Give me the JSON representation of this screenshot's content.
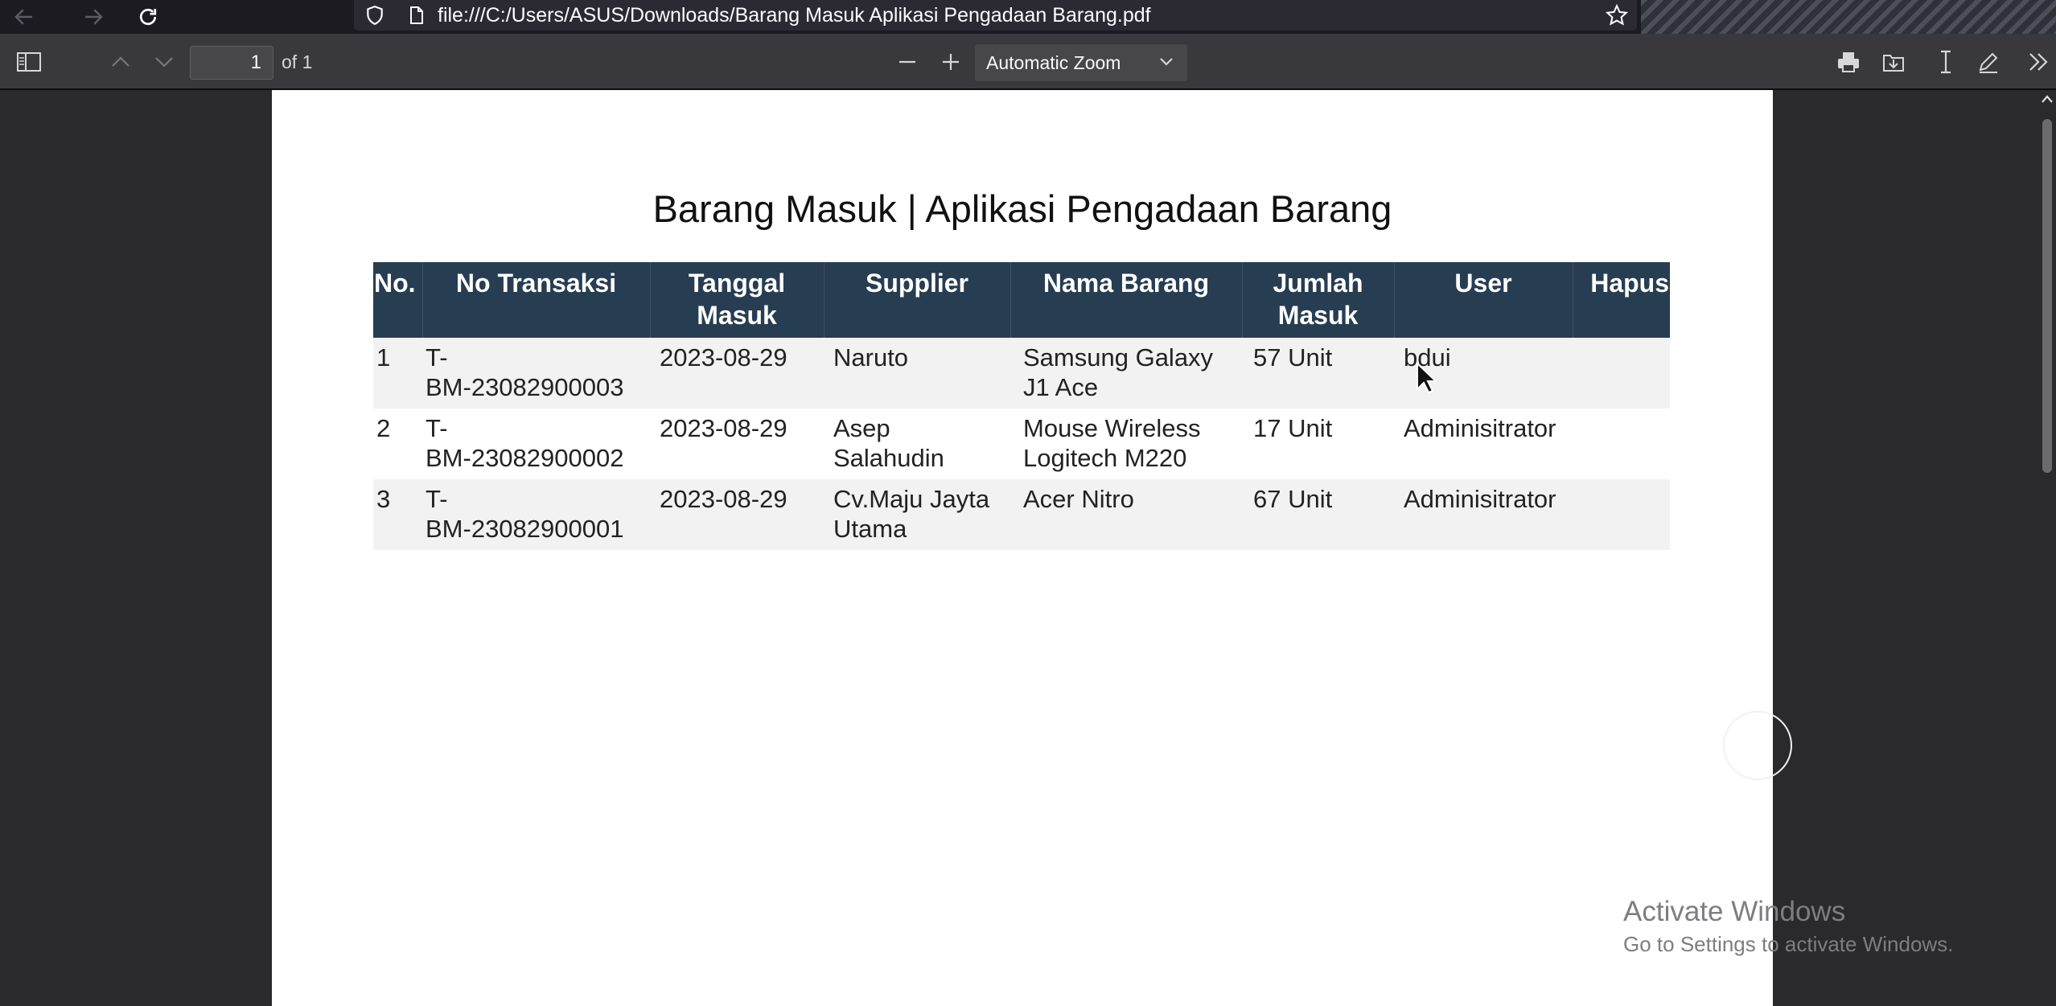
{
  "browser": {
    "url": "file:///C:/Users/ASUS/Downloads/Barang Masuk Aplikasi Pengadaan Barang.pdf"
  },
  "toolbar": {
    "page_number": "1",
    "page_count": "of 1",
    "zoom": "Automatic Zoom"
  },
  "document": {
    "title": "Barang Masuk | Aplikasi Pengadaan Barang",
    "headers": [
      "No.",
      "No Transaksi",
      "Tanggal Masuk",
      "Supplier",
      "Nama Barang",
      "Jumlah Masuk",
      "User",
      "Hapus"
    ],
    "rows": [
      {
        "no": "1",
        "transaksi": "T-BM-23082900003",
        "tanggal": "2023-08-29",
        "supplier": "Naruto",
        "barang": "Samsung Galaxy J1 Ace",
        "jumlah": "57 Unit",
        "user": "bdui",
        "hapus": ""
      },
      {
        "no": "2",
        "transaksi": "T-BM-23082900002",
        "tanggal": "2023-08-29",
        "supplier": "Asep Salahudin",
        "barang": "Mouse Wireless Logitech M220",
        "jumlah": "17 Unit",
        "user": "Adminisitrator",
        "hapus": ""
      },
      {
        "no": "3",
        "transaksi": "T-BM-23082900001",
        "tanggal": "2023-08-29",
        "supplier": "Cv.Maju Jayta Utama",
        "barang": "Acer Nitro",
        "jumlah": "67 Unit",
        "user": "Adminisitrator",
        "hapus": ""
      }
    ]
  },
  "watermark": {
    "line1": "Activate Windows",
    "line2": "Go to Settings to activate Windows."
  },
  "colors": {
    "table_header_bg": "#273d52",
    "toolbar_bg": "#38383d",
    "viewer_bg": "#2a2a2e"
  }
}
